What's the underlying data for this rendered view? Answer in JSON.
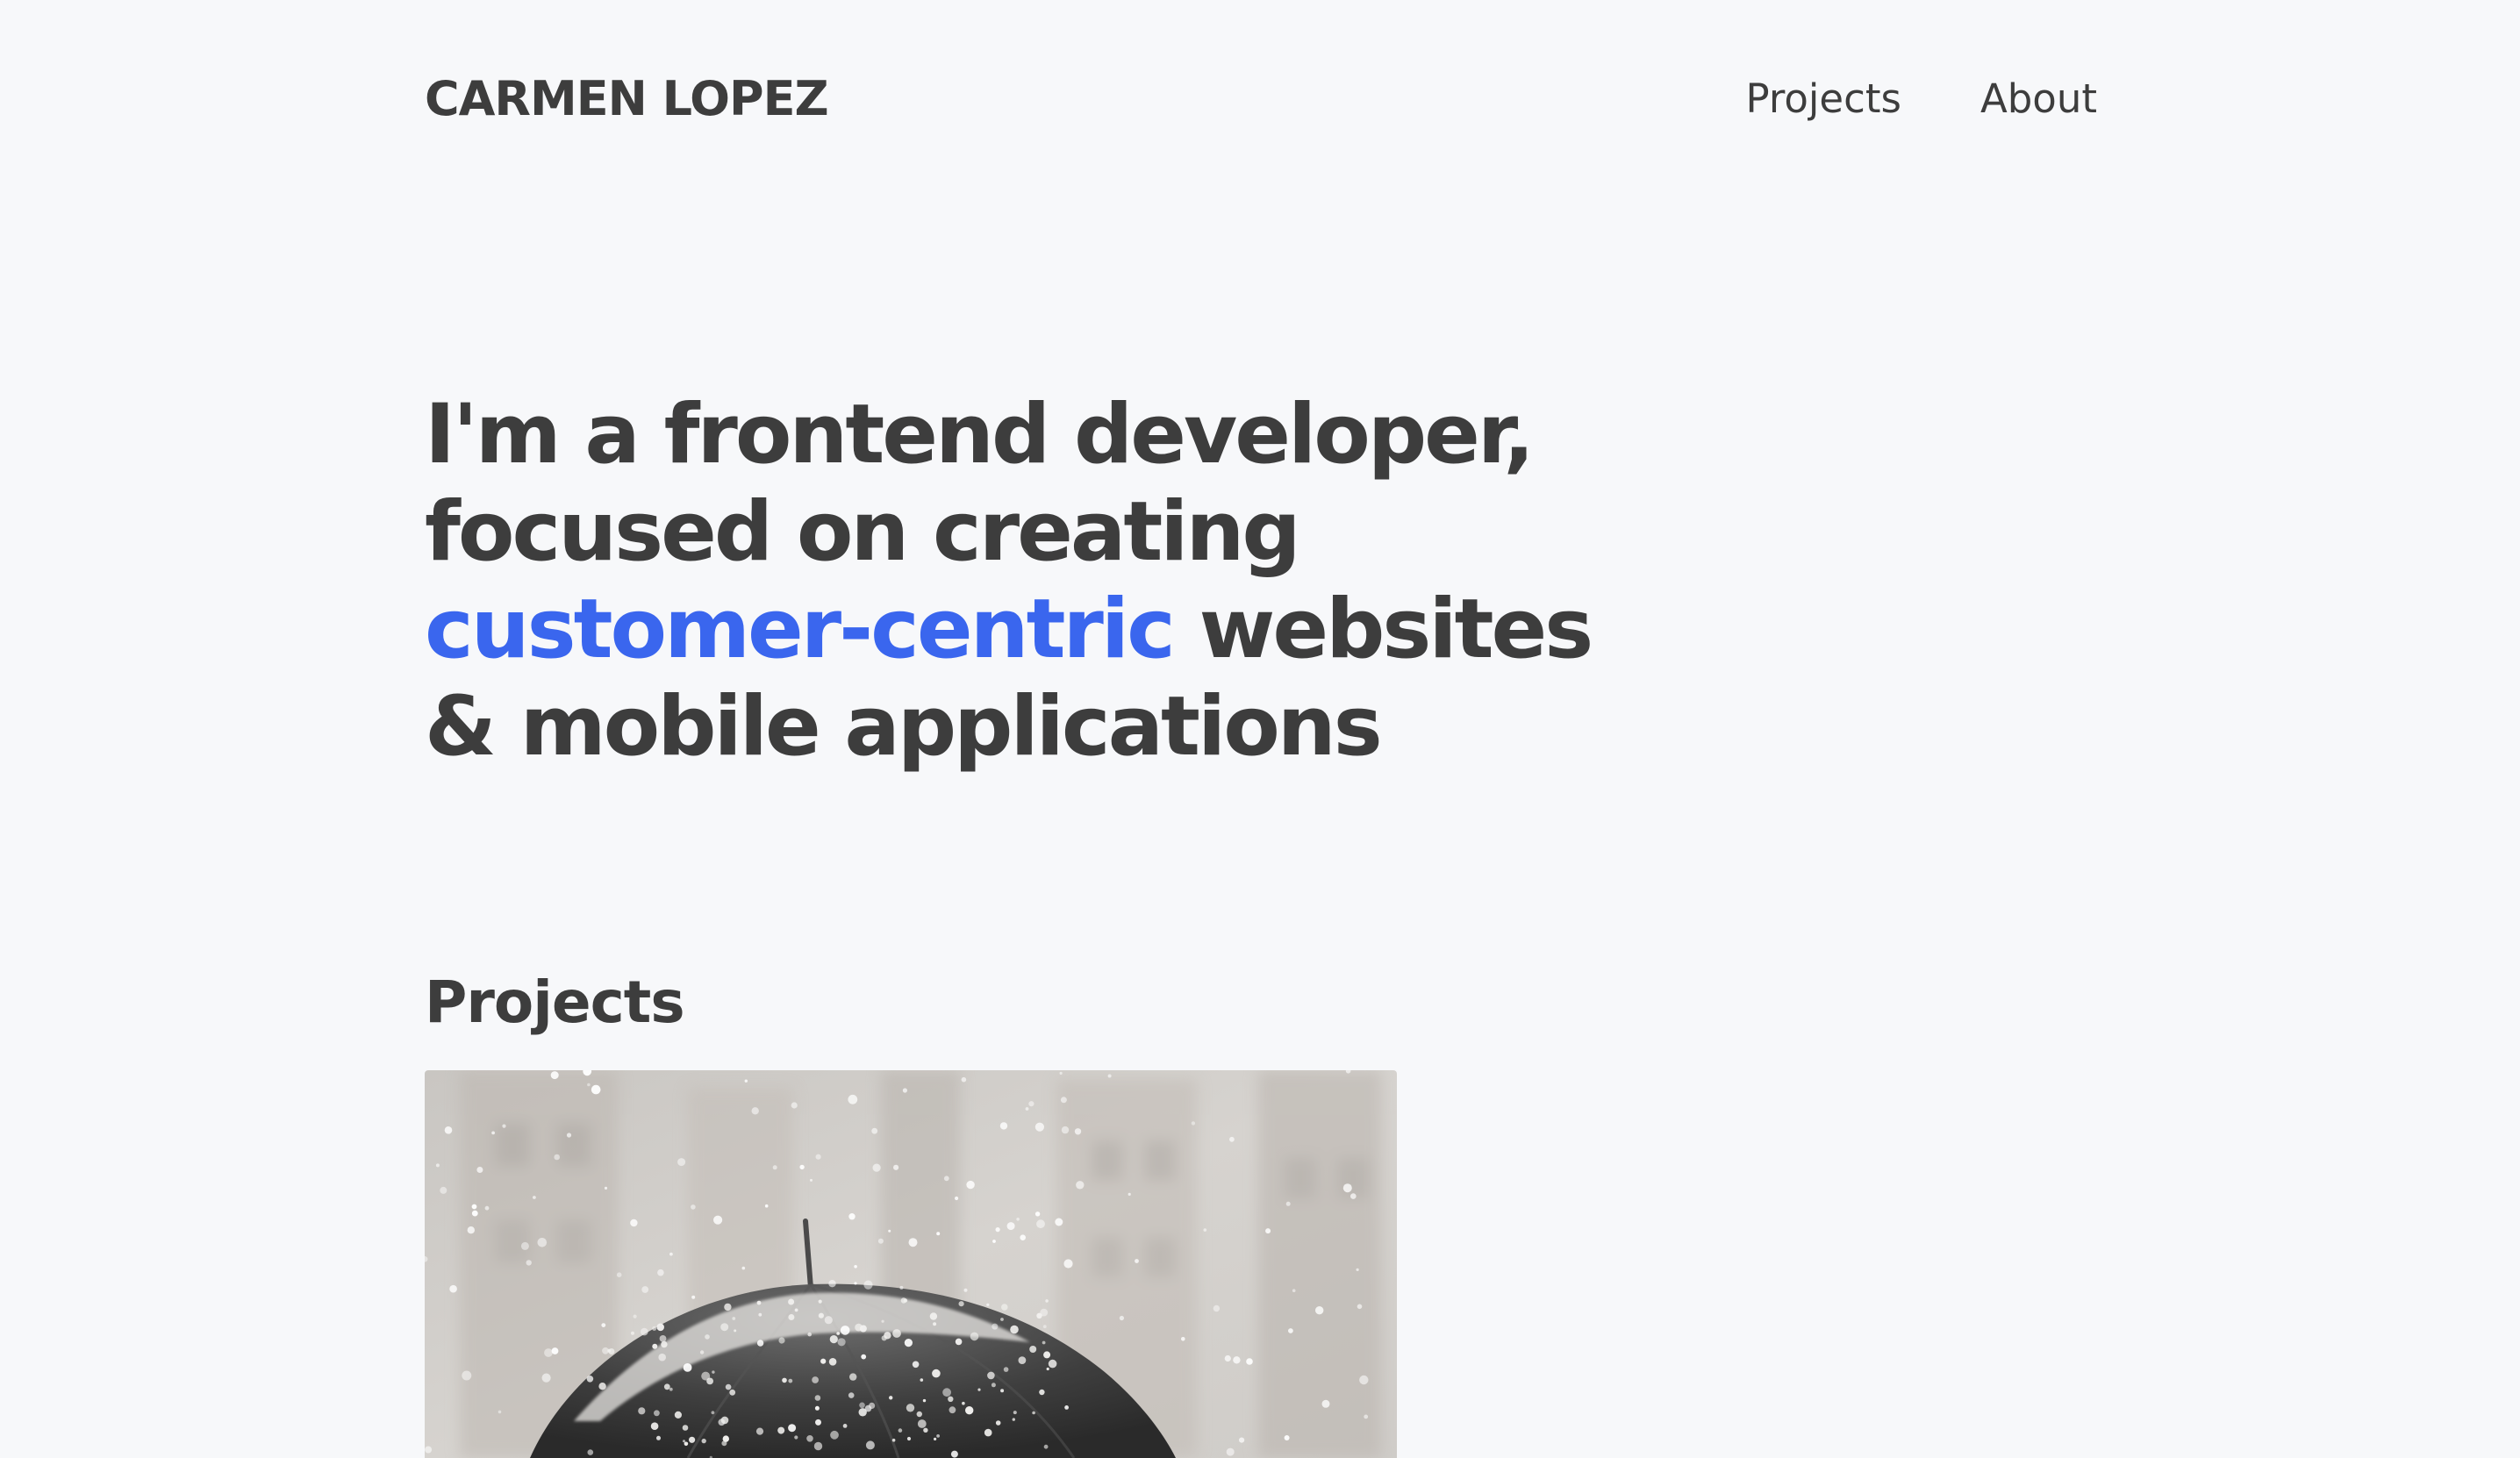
{
  "header": {
    "logo": "CARMEN LOPEZ",
    "nav": [
      {
        "label": "Projects"
      },
      {
        "label": "About"
      }
    ]
  },
  "hero": {
    "line1": "I'm a frontend developer,",
    "line2": "focused on creating",
    "line3_accent": "customer-centric",
    "line3_rest": " websites",
    "line4": "& mobile applications"
  },
  "projects": {
    "title": "Projects"
  },
  "colors": {
    "background": "#f7f8fa",
    "text": "#3d3d3d",
    "accent": "#3a66ee"
  }
}
